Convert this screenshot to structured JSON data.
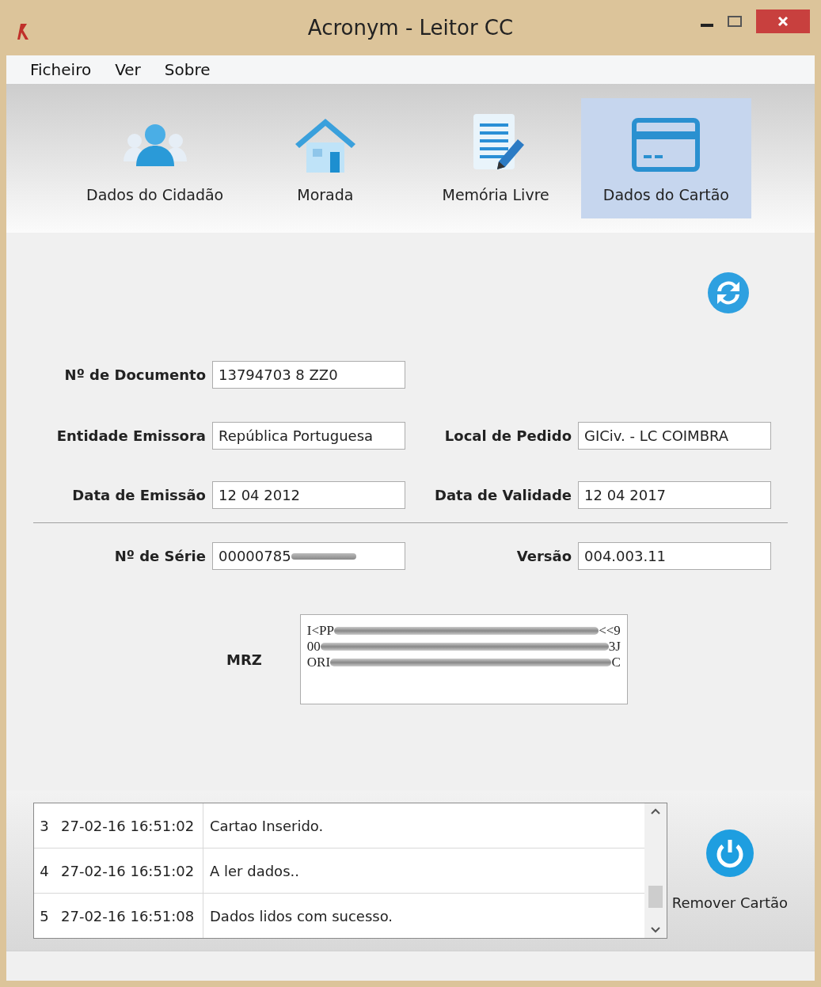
{
  "window": {
    "title": "Acronym - Leitor CC"
  },
  "menu": [
    "Ficheiro",
    "Ver",
    "Sobre"
  ],
  "tabs": [
    {
      "label": "Dados do Cidadão",
      "selected": false
    },
    {
      "label": "Morada",
      "selected": false
    },
    {
      "label": "Memória Livre",
      "selected": false
    },
    {
      "label": "Dados do Cartão",
      "selected": true
    }
  ],
  "fields": {
    "document_number": {
      "label": "Nº de Documento",
      "value": "13794703 8 ZZ0"
    },
    "issuer": {
      "label": "Entidade Emissora",
      "value": "República Portuguesa"
    },
    "request_location": {
      "label": "Local de Pedido",
      "value": "GICiv. - LC COIMBRA"
    },
    "issue_date": {
      "label": "Data de Emissão",
      "value": "12 04 2012"
    },
    "expiry_date": {
      "label": "Data de Validade",
      "value": "12 04 2017"
    },
    "serial_number": {
      "label": "Nº de Série",
      "value": "00000785",
      "redacted": true
    },
    "version": {
      "label": "Versão",
      "value": "004.003.11"
    },
    "mrz": {
      "label": "MRZ",
      "lines": [
        {
          "start": "I<PP",
          "end": "<<9"
        },
        {
          "start": "00",
          "end": "3J"
        },
        {
          "start": "ORI",
          "end": "C"
        }
      ]
    }
  },
  "log": [
    {
      "index": "3",
      "time": "27-02-16 16:51:02",
      "message": "Cartao Inserido."
    },
    {
      "index": "4",
      "time": "27-02-16 16:51:02",
      "message": "A ler dados.."
    },
    {
      "index": "5",
      "time": "27-02-16 16:51:08",
      "message": "Dados lidos com sucesso."
    }
  ],
  "remove_button": {
    "label": "Remover Cartão"
  }
}
